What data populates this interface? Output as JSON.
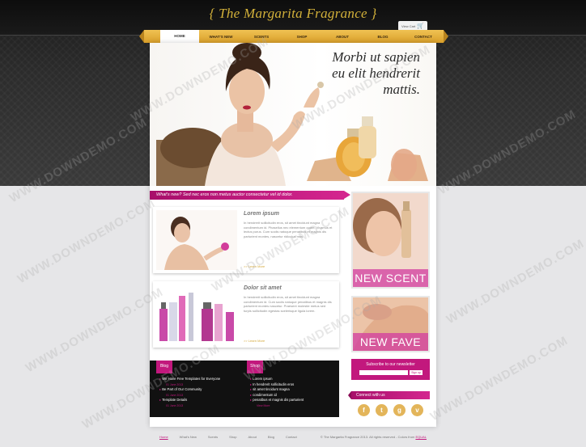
{
  "header": {
    "logo": "{ The Margarita Fragrance }",
    "cart_label": "View Cart"
  },
  "nav": {
    "items": [
      "HOME",
      "WHAT'S NEW",
      "SCENTS",
      "SHOP",
      "ABOUT",
      "BLOG",
      "CONTACT"
    ],
    "active": "HOME"
  },
  "hero": {
    "tagline_line1": "Morbi ut sapien",
    "tagline_line2": "eu elit hendrerit",
    "tagline_line3": "mattis."
  },
  "whats_new": "What's new? Sed nec eros non metus auctor consectetur vel id dolor.",
  "articles": [
    {
      "title": "Lorem ipsum",
      "body": "In hendrerit sollicitudin eros, sit amet tincidunt magna condimentum id. Phasellus nec elementum quam. Vivamus et lectus purus. Cum sociis natoque penatibus et magnis dis parturient montes, nascetur ridiculus mus.",
      "more": ">> Learn More"
    },
    {
      "title": "Dolor sit amet",
      "body": "In hendrerit sollicitudin eros, sit amet tincidunt magna condimentum id. Cum sociis natoque penatibus et magnis dis parturient montes nascetur. Praesent molestie metus sed turpis sollicitudin egestas scelerisque ligula lorem.",
      "more": ">> Learn More"
    }
  ],
  "promos": [
    {
      "caption": "NEW SCENT"
    },
    {
      "caption": "NEW FAVE"
    }
  ],
  "newsletter": {
    "label": "Subscribe to our newsletter",
    "button": "Sign up"
  },
  "connect": {
    "label": "Connect with us",
    "icons": [
      "f",
      "t",
      "g",
      "v"
    ]
  },
  "blog": {
    "tab": "Blog",
    "items": [
      {
        "title": "We Have Free Templates for Everyone",
        "date": "01 June 2013"
      },
      {
        "title": "Be Part of Our Community",
        "date": "01 June 2013"
      },
      {
        "title": "Template Details",
        "date": "01 June 2013"
      }
    ]
  },
  "shop": {
    "tab": "Shop",
    "items": [
      "Lorem ipsum",
      "In hendrerit sollicitudin eros",
      "sit amet tincidunt magna",
      "condimentum id",
      "penatibus et magnis dis parturient"
    ],
    "more": "View More"
  },
  "footer": {
    "links": [
      "Home",
      "What's New",
      "Scents",
      "Shop",
      "About",
      "Blog",
      "Contact"
    ],
    "active": "Home",
    "copyright": "© The Margarita Fragrance 2013. All rights reserved - Colors from",
    "copyright_link": "EQUAL"
  },
  "watermark": "WWW.DOWNDEMO.COM",
  "colors": {
    "accent": "#c2187d",
    "nav_gold": "#e3b040",
    "logo_gold": "#d4b23a",
    "dark_band": "#2a2a2a"
  }
}
